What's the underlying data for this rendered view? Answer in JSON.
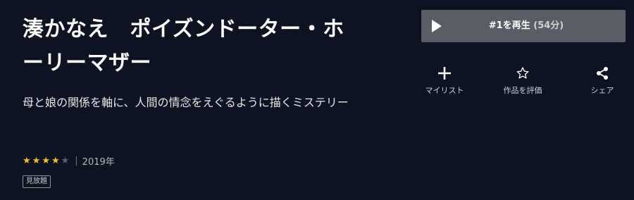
{
  "title": "湊かなえ　ポイズンドーター・ホーリーマザー",
  "description": "母と娘の関係を軸に、人間の情念をえぐるように描くミステリー",
  "rating": {
    "value": 4,
    "max": 5
  },
  "year": "2019年",
  "badge": "見放題",
  "play": {
    "label": "#1を再生",
    "duration": "(54分)"
  },
  "actions": [
    {
      "label": "マイリスト",
      "icon": "plus-icon"
    },
    {
      "label": "作品を評価",
      "icon": "star-outline-icon"
    },
    {
      "label": "シェア",
      "icon": "share-icon"
    }
  ],
  "colors": {
    "background": "#0d1321",
    "star": "#f3c22c",
    "play_button": "#5a5d63"
  }
}
